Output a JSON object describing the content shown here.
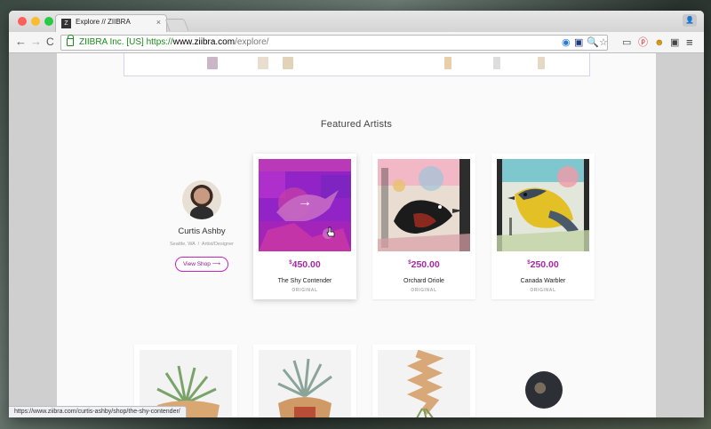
{
  "browser": {
    "tab_title": "Explore // ZIIBRA",
    "tab_favicon": "Z",
    "tab_close": "×",
    "back": "←",
    "forward": "→",
    "reload": "C",
    "profile_icon": "👤",
    "address": {
      "ev_label": "ZIIBRA Inc. [US]",
      "scheme": "https://",
      "host": "www.ziibra.com",
      "path": "/explore/"
    },
    "extensions": [
      "◉",
      "▣",
      "🔍",
      "☆",
      "▭",
      "ⓟ",
      "☻",
      "▣",
      "≡"
    ]
  },
  "page": {
    "section_title": "Featured Artists",
    "artist": {
      "name": "Curtis Ashby",
      "location": "Seattle, WA",
      "divider": "/",
      "role": "Artist/Designer",
      "view_shop_label": "View Shop",
      "view_shop_arrow": "⟶"
    },
    "products": [
      {
        "currency": "$",
        "price": "450.00",
        "title": "The Shy Contender",
        "tag": "ORIGINAL",
        "hover_arrow": "→"
      },
      {
        "currency": "$",
        "price": "250.00",
        "title": "Orchard Oriole",
        "tag": "ORIGINAL"
      },
      {
        "currency": "$",
        "price": "250.00",
        "title": "Canada Warbler",
        "tag": "ORIGINAL"
      }
    ]
  },
  "status_bar": {
    "url": "https://www.ziibra.com/curtis-ashby/shop/the-shy-contender/"
  },
  "colors": {
    "accent": "#a628a3",
    "ev_green": "#1a8a1a",
    "hover_overlay": "#a010b8"
  }
}
